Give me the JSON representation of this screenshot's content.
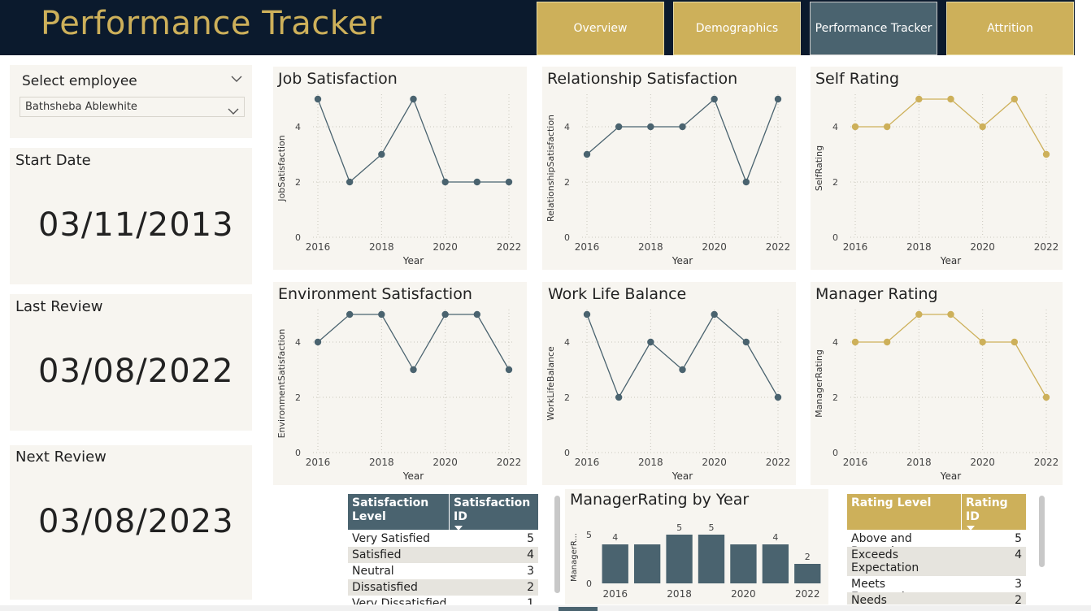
{
  "header": {
    "title": "Performance Tracker",
    "tabs": [
      {
        "label": "Overview",
        "active": false
      },
      {
        "label": "Demographics",
        "active": false
      },
      {
        "label": "Performance Tracker",
        "active": true
      },
      {
        "label": "Attrition",
        "active": false
      }
    ]
  },
  "colors": {
    "navy": "#0b1a2d",
    "gold": "#cdb05a",
    "slate": "#4a636f",
    "panel": "#f7f5f0"
  },
  "slicer": {
    "label": "Select employee",
    "value": "Bathsheba Ablewhite"
  },
  "cards": [
    {
      "title": "Start Date",
      "value": "03/11/2013"
    },
    {
      "title": "Last Review",
      "value": "03/08/2022"
    },
    {
      "title": "Next Review",
      "value": "03/08/2023"
    }
  ],
  "chart_data": [
    {
      "type": "line",
      "title": "Job Satisfaction",
      "xlabel": "Year",
      "ylabel": "JobSatisfaction",
      "x": [
        2016,
        2017,
        2018,
        2019,
        2020,
        2021,
        2022
      ],
      "values": [
        5,
        2,
        3,
        5,
        2,
        2,
        2
      ],
      "ylim": [
        0,
        5
      ],
      "xticks": [
        "2016",
        "2018",
        "2020",
        "2022"
      ],
      "yticks": [
        "0",
        "2",
        "4"
      ],
      "color": "#4a636f",
      "grid": true
    },
    {
      "type": "line",
      "title": "Relationship Satisfaction",
      "xlabel": "Year",
      "ylabel": "RelationshipSatisfaction",
      "x": [
        2016,
        2017,
        2018,
        2019,
        2020,
        2021,
        2022
      ],
      "values": [
        3,
        4,
        4,
        4,
        5,
        2,
        5
      ],
      "ylim": [
        0,
        5
      ],
      "xticks": [
        "2016",
        "2018",
        "2020",
        "2022"
      ],
      "yticks": [
        "0",
        "2",
        "4"
      ],
      "color": "#4a636f",
      "grid": true
    },
    {
      "type": "line",
      "title": "Self Rating",
      "xlabel": "Year",
      "ylabel": "SelfRating",
      "x": [
        2016,
        2017,
        2018,
        2019,
        2020,
        2021,
        2022
      ],
      "values": [
        4,
        4,
        5,
        5,
        4,
        5,
        3
      ],
      "ylim": [
        0,
        5
      ],
      "xticks": [
        "2016",
        "2018",
        "2020",
        "2022"
      ],
      "yticks": [
        "0",
        "2",
        "4"
      ],
      "color": "#cdb05a",
      "grid": true
    },
    {
      "type": "line",
      "title": "Environment Satisfaction",
      "xlabel": "Year",
      "ylabel": "EnvironmentSatisfaction",
      "x": [
        2016,
        2017,
        2018,
        2019,
        2020,
        2021,
        2022
      ],
      "values": [
        4,
        5,
        5,
        3,
        5,
        5,
        3
      ],
      "ylim": [
        0,
        5
      ],
      "xticks": [
        "2016",
        "2018",
        "2020",
        "2022"
      ],
      "yticks": [
        "0",
        "2",
        "4"
      ],
      "color": "#4a636f",
      "grid": true
    },
    {
      "type": "line",
      "title": "Work Life Balance",
      "xlabel": "Year",
      "ylabel": "WorkLifeBalance",
      "x": [
        2016,
        2017,
        2018,
        2019,
        2020,
        2021,
        2022
      ],
      "values": [
        5,
        2,
        4,
        3,
        5,
        4,
        2
      ],
      "ylim": [
        0,
        5
      ],
      "xticks": [
        "2016",
        "2018",
        "2020",
        "2022"
      ],
      "yticks": [
        "0",
        "2",
        "4"
      ],
      "color": "#4a636f",
      "grid": true
    },
    {
      "type": "line",
      "title": "Manager Rating",
      "xlabel": "Year",
      "ylabel": "ManagerRating",
      "x": [
        2016,
        2017,
        2018,
        2019,
        2020,
        2021,
        2022
      ],
      "values": [
        4,
        4,
        5,
        5,
        4,
        4,
        2
      ],
      "ylim": [
        0,
        5
      ],
      "xticks": [
        "2016",
        "2018",
        "2020",
        "2022"
      ],
      "yticks": [
        "0",
        "2",
        "4"
      ],
      "color": "#cdb05a",
      "grid": true
    },
    {
      "type": "bar",
      "title": "ManagerRating by Year",
      "ylabel": "ManagerR...",
      "categories": [
        "2016",
        "2017",
        "2018",
        "2019",
        "2020",
        "2021",
        "2022"
      ],
      "values": [
        4,
        4,
        5,
        5,
        4,
        4,
        2
      ],
      "data_labels": [
        "4",
        "",
        "5",
        "5",
        "",
        "4",
        "2"
      ],
      "ylim": [
        0,
        5
      ],
      "xticks": [
        "2016",
        "2018",
        "2020",
        "2022"
      ],
      "yticks": [
        "0",
        "5"
      ],
      "color": "#4a636f"
    }
  ],
  "satisfaction_table": {
    "columns": [
      "Satisfaction Level",
      "Satisfaction ID"
    ],
    "rows": [
      {
        "level": "Very Satisfied",
        "id": "5"
      },
      {
        "level": "Satisfied",
        "id": "4"
      },
      {
        "level": "Neutral",
        "id": "3"
      },
      {
        "level": "Dissatisfied",
        "id": "2"
      },
      {
        "level": "Very Dissatisfied",
        "id": "1"
      }
    ]
  },
  "rating_table": {
    "columns": [
      "Rating Level",
      "Rating ID"
    ],
    "rows": [
      {
        "level": "Above and Beyond",
        "id": "5"
      },
      {
        "level": "Exceeds Expectation",
        "id": "4"
      },
      {
        "level": "Meets Expectation",
        "id": "3"
      },
      {
        "level": "Needs",
        "id": "2"
      }
    ]
  }
}
